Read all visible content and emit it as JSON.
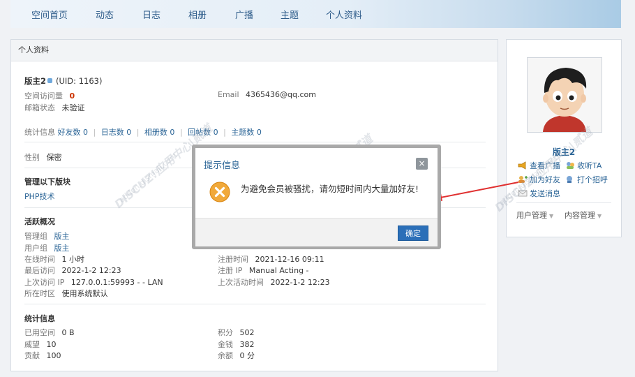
{
  "nav": [
    "空间首页",
    "动态",
    "日志",
    "相册",
    "广播",
    "主题",
    "个人资料"
  ],
  "panel_title": "个人资料",
  "user": {
    "name": "版主2",
    "uid": "(UID: 1163)",
    "visits_label": "空间访问量",
    "visits": "0",
    "email_label": "Email",
    "email": "4365436@qq.com",
    "mail_status_label": "邮箱状态",
    "mail_status": "未验证"
  },
  "stats": {
    "label": "统计信息",
    "links": [
      "好友数 0",
      "日志数 0",
      "相册数 0",
      "回帖数 0",
      "主题数 0"
    ]
  },
  "gender": {
    "label": "性别",
    "value": "保密"
  },
  "manage": {
    "title": "管理以下版块",
    "forum": "PHP技术"
  },
  "activity": {
    "title": "活跃概况",
    "admin_group_label": "管理组",
    "admin_group": "版主",
    "user_group_label": "用户组",
    "user_group": "版主",
    "online_label": "在线时间",
    "online": "1 小时",
    "register_time_label": "注册时间",
    "register_time": "2021-12-16 09:11",
    "last_visit_label": "最后访问",
    "last_visit": "2022-1-2 12:23",
    "register_ip_label": "注册 IP",
    "register_ip": "Manual Acting -",
    "last_ip_label": "上次访问 IP",
    "last_ip": "127.0.0.1:59993 - - LAN",
    "last_active_label": "上次活动时间",
    "last_active": "2022-1-2 12:23",
    "timezone_label": "所在时区",
    "timezone": "使用系统默认"
  },
  "stats2": {
    "title": "统计信息",
    "space_label": "已用空间",
    "space": "0 B",
    "points_label": "积分",
    "points": "502",
    "prestige_label": "威望",
    "prestige": "10",
    "money_label": "金钱",
    "money": "382",
    "contrib_label": "贡献",
    "contrib": "100",
    "balance_label": "余额",
    "balance": "0 分"
  },
  "side": {
    "name": "版主2",
    "actions": [
      "查看广播",
      "收听TA",
      "加为好友",
      "打个招呼",
      "发送消息"
    ],
    "menus": [
      "用户管理",
      "内容管理"
    ]
  },
  "dialog": {
    "title": "提示信息",
    "close": "×",
    "message": "为避免会员被骚扰，请勿短时间内大量加好友!",
    "ok": "确定"
  },
  "watermark": {
    "brand": "DISCUZ!应用中心|贰道",
    "url": "addon.dismall.com"
  },
  "colors": {
    "accent": "#2b6fb8",
    "link": "#2a6496",
    "red": "#cc3300",
    "arrow": "#e03030"
  }
}
